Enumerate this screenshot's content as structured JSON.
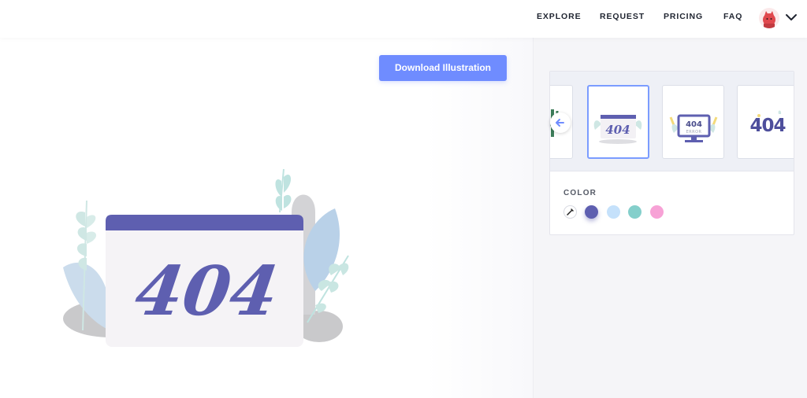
{
  "nav": {
    "links": [
      "EXPLORE",
      "REQUEST",
      "PRICING",
      "FAQ"
    ],
    "avatar_icon": "user-avatar-icon",
    "menu_icon": "chevron-down-icon"
  },
  "canvas": {
    "download_label": "Download Illustration",
    "illustration_text": "404",
    "accent_color": "#5e5fb0"
  },
  "panel": {
    "thumbnails": [
      {
        "name": "cactus-404-thumbnail",
        "text": ""
      },
      {
        "name": "browser-404-thumbnail",
        "text": "404"
      },
      {
        "name": "monitor-404-error-thumbnail",
        "text": "404",
        "subtext": "ERROR"
      },
      {
        "name": "big-404-thumbnail",
        "text": "404"
      }
    ],
    "prev_icon": "arrow-left-icon",
    "color_label": "COLOR",
    "colors": [
      "#5e5fb0",
      "#c5e1fb",
      "#84cfcb",
      "#f7a2d6"
    ],
    "selected_color": "#5e5fb0",
    "picker_icon": "eyedropper-icon"
  }
}
